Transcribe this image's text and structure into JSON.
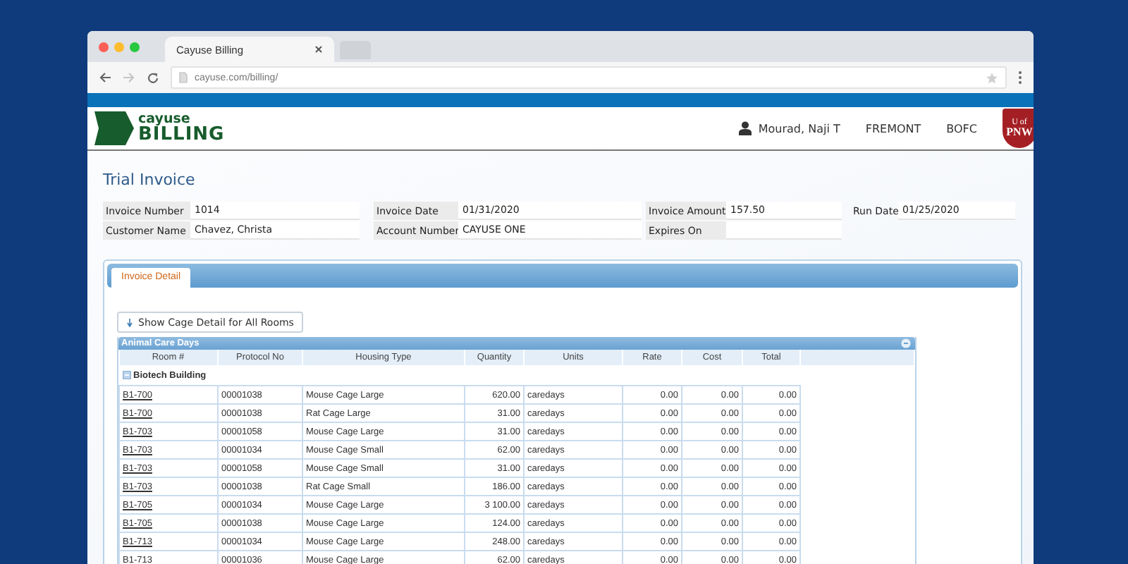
{
  "browser": {
    "tab_title": "Cayuse Billing",
    "url": "cayuse.com/billing/"
  },
  "header": {
    "logo_top": "cayuse",
    "logo_bottom": "BILLING",
    "user": "Mourad, Naji T",
    "location": "FREMONT",
    "org": "BOFC",
    "badge_top": "U of",
    "badge_bottom": "PNW"
  },
  "page_title": "Trial Invoice",
  "fields": [
    [
      {
        "label": "Invoice Number",
        "value": "1014"
      },
      {
        "label": "Invoice Date",
        "value": "01/31/2020"
      },
      {
        "label": "Invoice Amount",
        "value": "157.50"
      },
      {
        "label": "Run Date",
        "value": "01/25/2020"
      }
    ],
    [
      {
        "label": "Customer Name",
        "value": "Chavez, Christa"
      },
      {
        "label": "Account Number",
        "value": "CAYUSE ONE"
      },
      {
        "label": "Expires On"
      }
    ]
  ],
  "tabs": [
    {
      "label": "Invoice Detail",
      "selected": true
    }
  ],
  "show_button": "Show Cage Detail for All Rooms",
  "table": {
    "title": "Animal Care Days",
    "columns": [
      "Room #",
      "Protocol No",
      "Housing Type",
      "Quantity",
      "Units",
      "Rate",
      "Cost",
      "Total"
    ],
    "groups": [
      {
        "name": "Biotech Building",
        "expanded": true,
        "rows": [
          [
            "B1-700",
            "00001038",
            "Mouse Cage Large",
            "620.00",
            "caredays",
            "0.00",
            "0.00",
            "0.00"
          ],
          [
            "B1-700",
            "00001038",
            "Rat Cage Large",
            "31.00",
            "caredays",
            "0.00",
            "0.00",
            "0.00"
          ],
          [
            "B1-703",
            "00001058",
            "Mouse Cage Large",
            "31.00",
            "caredays",
            "0.00",
            "0.00",
            "0.00"
          ],
          [
            "B1-703",
            "00001034",
            "Mouse Cage Small",
            "62.00",
            "caredays",
            "0.00",
            "0.00",
            "0.00"
          ],
          [
            "B1-703",
            "00001058",
            "Mouse Cage Small",
            "31.00",
            "caredays",
            "0.00",
            "0.00",
            "0.00"
          ],
          [
            "B1-703",
            "00001038",
            "Rat Cage Small",
            "186.00",
            "caredays",
            "0.00",
            "0.00",
            "0.00"
          ],
          [
            "B1-705",
            "00001034",
            "Mouse Cage Large",
            "3 100.00",
            "caredays",
            "0.00",
            "0.00",
            "0.00"
          ],
          [
            "B1-705",
            "00001038",
            "Mouse Cage Large",
            "124.00",
            "caredays",
            "0.00",
            "0.00",
            "0.00"
          ],
          [
            "B1-713",
            "00001034",
            "Mouse Cage Large",
            "248.00",
            "caredays",
            "0.00",
            "0.00",
            "0.00"
          ],
          [
            "B1-713",
            "00001036",
            "Mouse Cage Large",
            "62.00",
            "caredays",
            "0.00",
            "0.00",
            "0.00"
          ]
        ]
      }
    ]
  }
}
